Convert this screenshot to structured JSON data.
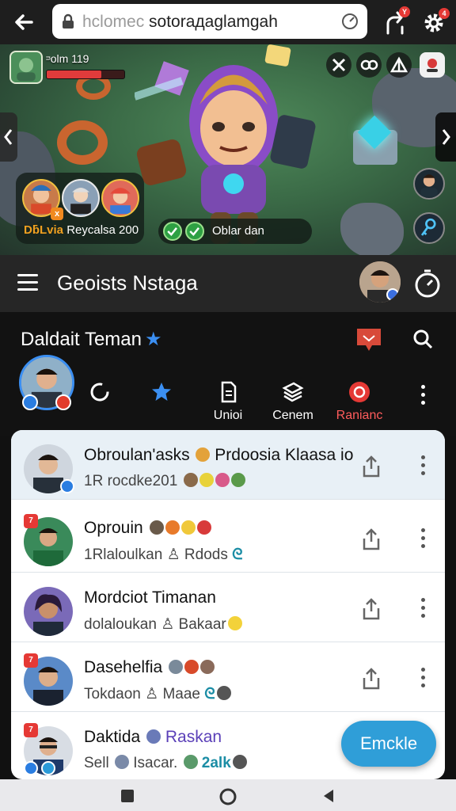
{
  "browser": {
    "url_dim": "hclomec",
    "url_main": "sotoraдaglamgah",
    "notification_badge": "Y",
    "settings_badge": "4"
  },
  "game": {
    "player_name": "ᵙolm  119",
    "health_fraction": 0.7,
    "team_label_orange": "DƃLvia",
    "team_label_rest": "Reycalsa 200",
    "status_text": "Oblar dan",
    "team_badge": "x"
  },
  "header": {
    "title": "Geoists Nstaga"
  },
  "profile": {
    "name": "Daldait Teman",
    "actions": [
      {
        "label": ""
      },
      {
        "label": ""
      },
      {
        "label": "Unioi"
      },
      {
        "label": "Cenem"
      },
      {
        "label": "Ranianc"
      }
    ]
  },
  "list": [
    {
      "title": "Obroulan'asks",
      "title_rest": "Prdoosia Klaasa io",
      "sub": "1R rocdke201"
    },
    {
      "tag": "7",
      "title": "Oprouin",
      "title_rest": "",
      "sub": "1Rlaloulkan",
      "sub_rest": "Rdods"
    },
    {
      "title": "Mordciot Timanan",
      "title_rest": "",
      "sub": "dolaloukan",
      "sub_rest": "Bakaar"
    },
    {
      "tag": "7",
      "title": "Dasehelfia",
      "title_rest": "",
      "sub": "Tokdaon",
      "sub_rest": "Maae"
    },
    {
      "tag": "7",
      "title": "Daktida",
      "title_rest": "Raskan",
      "sub": "Sell",
      "sub_mid": "Isacar.",
      "sub_rest": "2alk"
    }
  ],
  "fab_label": "Emckle",
  "colors": {
    "accent": "#2f9ed8",
    "header_bg": "#262626",
    "profile_bg": "#121212",
    "star": "#3b8ff2",
    "danger": "#e53935"
  },
  "icons": [
    "back-arrow-icon",
    "lock-icon",
    "refresh-icon",
    "route-icon",
    "gear-icon",
    "hamburger-icon",
    "timer-icon",
    "message-icon",
    "search-icon",
    "share-icon",
    "kebab-icon"
  ]
}
